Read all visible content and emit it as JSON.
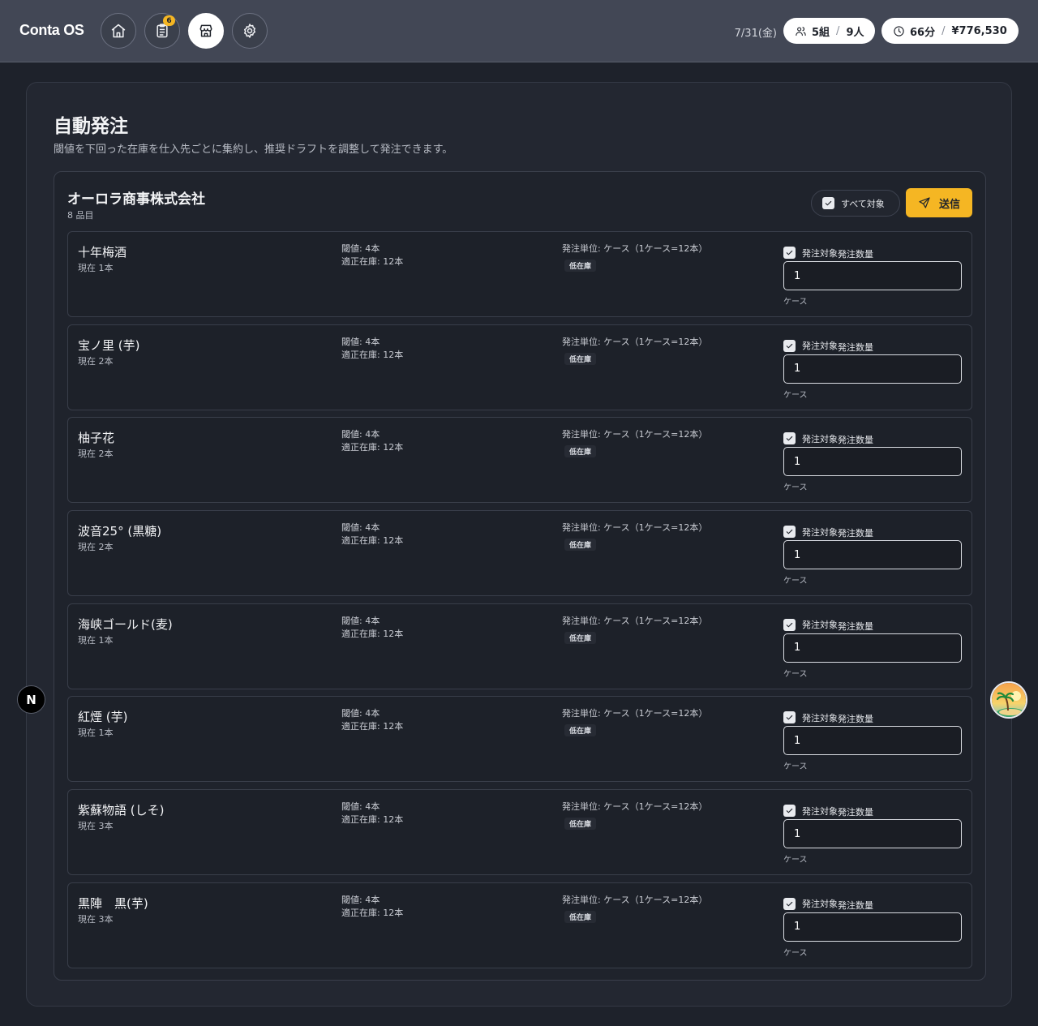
{
  "header": {
    "brand": "Conta OS",
    "nav": [
      {
        "icon": "home-icon"
      },
      {
        "icon": "clipboard-icon",
        "badge": "6"
      },
      {
        "icon": "store-icon",
        "active": true
      },
      {
        "icon": "gear-icon"
      }
    ],
    "date": "7/31(金)",
    "groups": "5組",
    "people": "9人",
    "minutes": "66分",
    "sales": "¥776,530"
  },
  "page": {
    "title": "自動発注",
    "subtitle": "閾値を下回った在庫を仕入先ごとに集約し、推奨ドラフトを調整して発注できます。"
  },
  "supplier": {
    "name": "オーロラ商事株式会社",
    "count": "8 品目",
    "select_all_label": "すべて対象",
    "send_label": "送信"
  },
  "items": [
    {
      "name": "十年梅酒",
      "stock": "現在 1本",
      "threshold": "閾値: 4本",
      "optimal": "適正在庫: 12本",
      "unit": "発注単位: ケース（1ケース=12本）",
      "status": "低在庫",
      "target_label": "発注対象",
      "qty_label": "発注数量",
      "qty": "1",
      "qty_unit": "ケース"
    },
    {
      "name": "宝ノ里 (芋)",
      "stock": "現在 2本",
      "threshold": "閾値: 4本",
      "optimal": "適正在庫: 12本",
      "unit": "発注単位: ケース（1ケース=12本）",
      "status": "低在庫",
      "target_label": "発注対象",
      "qty_label": "発注数量",
      "qty": "1",
      "qty_unit": "ケース"
    },
    {
      "name": "柚子花",
      "stock": "現在 2本",
      "threshold": "閾値: 4本",
      "optimal": "適正在庫: 12本",
      "unit": "発注単位: ケース（1ケース=12本）",
      "status": "低在庫",
      "target_label": "発注対象",
      "qty_label": "発注数量",
      "qty": "1",
      "qty_unit": "ケース"
    },
    {
      "name": "波音25° (黒糖)",
      "stock": "現在 2本",
      "threshold": "閾値: 4本",
      "optimal": "適正在庫: 12本",
      "unit": "発注単位: ケース（1ケース=12本）",
      "status": "低在庫",
      "target_label": "発注対象",
      "qty_label": "発注数量",
      "qty": "1",
      "qty_unit": "ケース"
    },
    {
      "name": "海峡ゴールド(麦)",
      "stock": "現在 1本",
      "threshold": "閾値: 4本",
      "optimal": "適正在庫: 12本",
      "unit": "発注単位: ケース（1ケース=12本）",
      "status": "低在庫",
      "target_label": "発注対象",
      "qty_label": "発注数量",
      "qty": "1",
      "qty_unit": "ケース"
    },
    {
      "name": "紅煙 (芋)",
      "stock": "現在 1本",
      "threshold": "閾値: 4本",
      "optimal": "適正在庫: 12本",
      "unit": "発注単位: ケース（1ケース=12本）",
      "status": "低在庫",
      "target_label": "発注対象",
      "qty_label": "発注数量",
      "qty": "1",
      "qty_unit": "ケース"
    },
    {
      "name": "紫蘇物語 (しそ)",
      "stock": "現在 3本",
      "threshold": "閾値: 4本",
      "optimal": "適正在庫: 12本",
      "unit": "発注単位: ケース（1ケース=12本）",
      "status": "低在庫",
      "target_label": "発注対象",
      "qty_label": "発注数量",
      "qty": "1",
      "qty_unit": "ケース"
    },
    {
      "name": "黒陣　黒(芋)",
      "stock": "現在 3本",
      "threshold": "閾値: 4本",
      "optimal": "適正在庫: 12本",
      "unit": "発注単位: ケース（1ケース=12本）",
      "status": "低在庫",
      "target_label": "発注対象",
      "qty_label": "発注数量",
      "qty": "1",
      "qty_unit": "ケース"
    }
  ],
  "floating": {
    "devtools_letter": "N"
  }
}
